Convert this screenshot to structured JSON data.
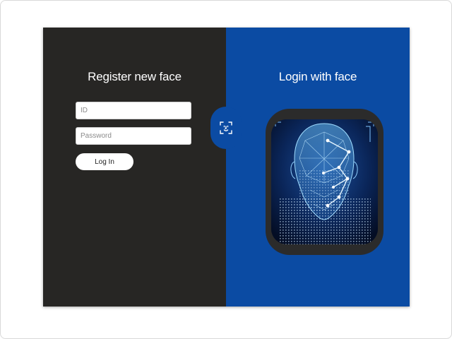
{
  "register_panel": {
    "heading": "Register new face",
    "id_placeholder": "ID",
    "password_placeholder": "Password",
    "login_button_label": "Log In"
  },
  "face_toggle": {
    "icon": "face-scan-icon"
  },
  "login_panel": {
    "heading": "Login with face",
    "image_icon": "face-recognition-illustration"
  },
  "colors": {
    "left_panel": "#272624",
    "right_panel": "#0b4ba3",
    "face_frame": "#2b2b2b",
    "face_glow": "#3fa9f5"
  }
}
